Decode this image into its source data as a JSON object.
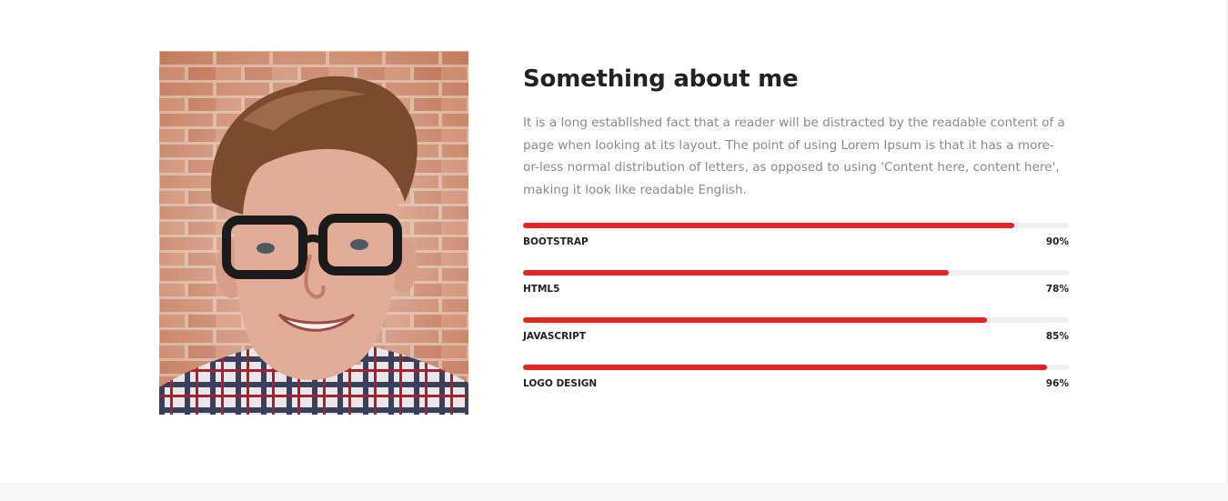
{
  "about": {
    "heading": "Something about me",
    "intro": "It is a long established fact that a reader will be distracted by the readable content of a page when looking at its layout. The point of using Lorem Ipsum is that it has a more-or-less normal distribution of letters, as opposed to using 'Content here, content here', making it look like readable English.",
    "photo_icon": "portrait-photo",
    "skills": [
      {
        "label": "BOOTSTRAP",
        "percent_text": "90%",
        "level": 0.9
      },
      {
        "label": "HTML5",
        "percent_text": "78%",
        "level": 0.78
      },
      {
        "label": "JAVASCRIPT",
        "percent_text": "85%",
        "level": 0.85
      },
      {
        "label": "LOGO DESIGN",
        "percent_text": "96%",
        "level": 0.96
      }
    ]
  },
  "colors": {
    "accent": "#e62224",
    "heading": "#222222",
    "body_text": "#8a8a8a",
    "track": "#efefef",
    "footer": "#f7f7f7"
  }
}
